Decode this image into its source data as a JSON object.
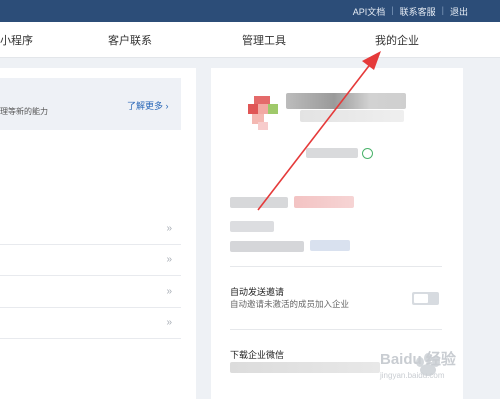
{
  "topbar": {
    "api_docs": "API文档",
    "sep": "|",
    "support": "联系客服",
    "logout": "退出"
  },
  "nav": {
    "mini_program": "小程序",
    "contacts": "客户联系",
    "management": "管理工具",
    "my_company": "我的企业"
  },
  "main": {
    "banner_text": "理等新的能力",
    "learn_more": "了解更多 ›",
    "row_chevron": "»"
  },
  "company": {
    "auto_invite_title": "自动发送邀请",
    "auto_invite_desc": "自动邀请未激活的成员加入企业",
    "download_title": "下载企业微信"
  },
  "watermark": {
    "text": "Baidu 经验",
    "url": "jingyan.baidu.com"
  },
  "colors": {
    "topbar": "#2c4d78",
    "link": "#2a68b8",
    "arrow": "#e53a3a"
  }
}
